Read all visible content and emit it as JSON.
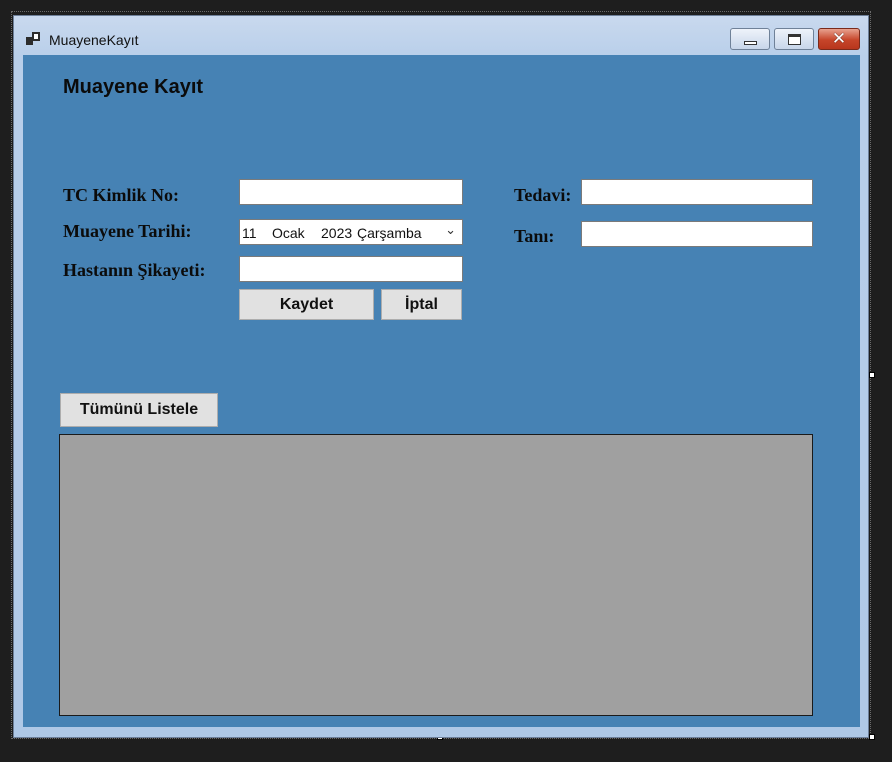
{
  "window": {
    "title": "MuayeneKayıt"
  },
  "form": {
    "heading": "Muayene Kayıt",
    "labels": {
      "tc": "TC Kimlik No:",
      "date": "Muayene Tarihi:",
      "complaint": "Hastanın Şikayeti:",
      "treatment": "Tedavi:",
      "diagnosis": "Tanı:"
    },
    "fields": {
      "tc": "",
      "complaint": "",
      "treatment": "",
      "diagnosis": ""
    },
    "date": {
      "day": "11",
      "month": "Ocak",
      "year": "2023",
      "weekday": "Çarşamba"
    },
    "buttons": {
      "save": "Kaydet",
      "cancel": "İptal",
      "list_all": "Tümünü Listele"
    }
  }
}
